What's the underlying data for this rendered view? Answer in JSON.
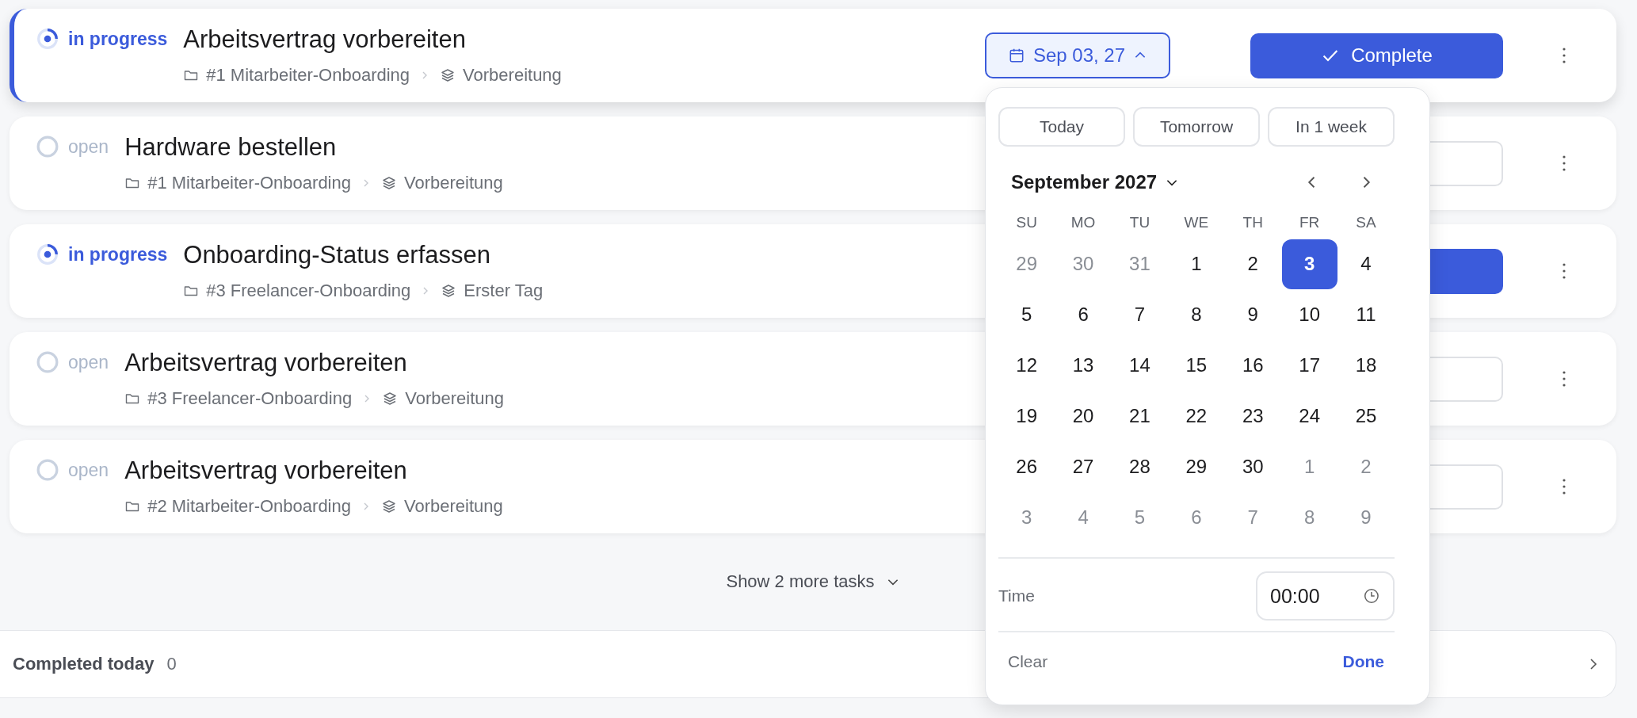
{
  "tasks": [
    {
      "kind": "in_progress",
      "status_label": "in progress",
      "title": "Arbeitsvertrag vorbereiten",
      "project": "#1 Mitarbeiter-Onboarding",
      "phase": "Vorbereitung",
      "active": true,
      "due": "Sep 03, 27",
      "due_open": true,
      "action": {
        "kind": "filled",
        "label": "Complete"
      }
    },
    {
      "kind": "open",
      "status_label": "open",
      "title": "Hardware bestellen",
      "project": "#1 Mitarbeiter-Onboarding",
      "phase": "Vorbereitung",
      "active": false,
      "action": {
        "kind": "outline"
      }
    },
    {
      "kind": "in_progress",
      "status_label": "in progress",
      "title": "Onboarding-Status erfassen",
      "project": "#3 Freelancer-Onboarding",
      "phase": "Erster Tag",
      "active": false,
      "action": {
        "kind": "filled"
      }
    },
    {
      "kind": "open",
      "status_label": "open",
      "title": "Arbeitsvertrag vorbereiten",
      "project": "#3 Freelancer-Onboarding",
      "phase": "Vorbereitung",
      "active": false,
      "action": {
        "kind": "outline"
      }
    },
    {
      "kind": "open",
      "status_label": "open",
      "title": "Arbeitsvertrag vorbereiten",
      "project": "#2 Mitarbeiter-Onboarding",
      "phase": "Vorbereitung",
      "active": false,
      "action": {
        "kind": "outline"
      }
    }
  ],
  "show_more": "Show 2 more tasks",
  "completed": {
    "label": "Completed today",
    "count": "0"
  },
  "date_picker": {
    "quick": [
      "Today",
      "Tomorrow",
      "In 1 week"
    ],
    "month": "September 2027",
    "weekdays": [
      "SU",
      "MO",
      "TU",
      "WE",
      "TH",
      "FR",
      "SA"
    ],
    "weeks": [
      [
        {
          "day": "29",
          "outside": true,
          "selected": false
        },
        {
          "day": "30",
          "outside": true,
          "selected": false
        },
        {
          "day": "31",
          "outside": true,
          "selected": false
        },
        {
          "day": "1",
          "outside": false,
          "selected": false
        },
        {
          "day": "2",
          "outside": false,
          "selected": false
        },
        {
          "day": "3",
          "outside": false,
          "selected": true
        },
        {
          "day": "4",
          "outside": false,
          "selected": false
        }
      ],
      [
        {
          "day": "5",
          "outside": false,
          "selected": false
        },
        {
          "day": "6",
          "outside": false,
          "selected": false
        },
        {
          "day": "7",
          "outside": false,
          "selected": false
        },
        {
          "day": "8",
          "outside": false,
          "selected": false
        },
        {
          "day": "9",
          "outside": false,
          "selected": false
        },
        {
          "day": "10",
          "outside": false,
          "selected": false
        },
        {
          "day": "11",
          "outside": false,
          "selected": false
        }
      ],
      [
        {
          "day": "12",
          "outside": false,
          "selected": false
        },
        {
          "day": "13",
          "outside": false,
          "selected": false
        },
        {
          "day": "14",
          "outside": false,
          "selected": false
        },
        {
          "day": "15",
          "outside": false,
          "selected": false
        },
        {
          "day": "16",
          "outside": false,
          "selected": false
        },
        {
          "day": "17",
          "outside": false,
          "selected": false
        },
        {
          "day": "18",
          "outside": false,
          "selected": false
        }
      ],
      [
        {
          "day": "19",
          "outside": false,
          "selected": false
        },
        {
          "day": "20",
          "outside": false,
          "selected": false
        },
        {
          "day": "21",
          "outside": false,
          "selected": false
        },
        {
          "day": "22",
          "outside": false,
          "selected": false
        },
        {
          "day": "23",
          "outside": false,
          "selected": false
        },
        {
          "day": "24",
          "outside": false,
          "selected": false
        },
        {
          "day": "25",
          "outside": false,
          "selected": false
        }
      ],
      [
        {
          "day": "26",
          "outside": false,
          "selected": false
        },
        {
          "day": "27",
          "outside": false,
          "selected": false
        },
        {
          "day": "28",
          "outside": false,
          "selected": false
        },
        {
          "day": "29",
          "outside": false,
          "selected": false
        },
        {
          "day": "30",
          "outside": false,
          "selected": false
        },
        {
          "day": "1",
          "outside": true,
          "selected": false
        },
        {
          "day": "2",
          "outside": true,
          "selected": false
        }
      ],
      [
        {
          "day": "3",
          "outside": true,
          "selected": false
        },
        {
          "day": "4",
          "outside": true,
          "selected": false
        },
        {
          "day": "5",
          "outside": true,
          "selected": false
        },
        {
          "day": "6",
          "outside": true,
          "selected": false
        },
        {
          "day": "7",
          "outside": true,
          "selected": false
        },
        {
          "day": "8",
          "outside": true,
          "selected": false
        },
        {
          "day": "9",
          "outside": true,
          "selected": false
        }
      ]
    ],
    "time_label": "Time",
    "time": "00:00",
    "clear": "Clear",
    "done": "Done"
  }
}
